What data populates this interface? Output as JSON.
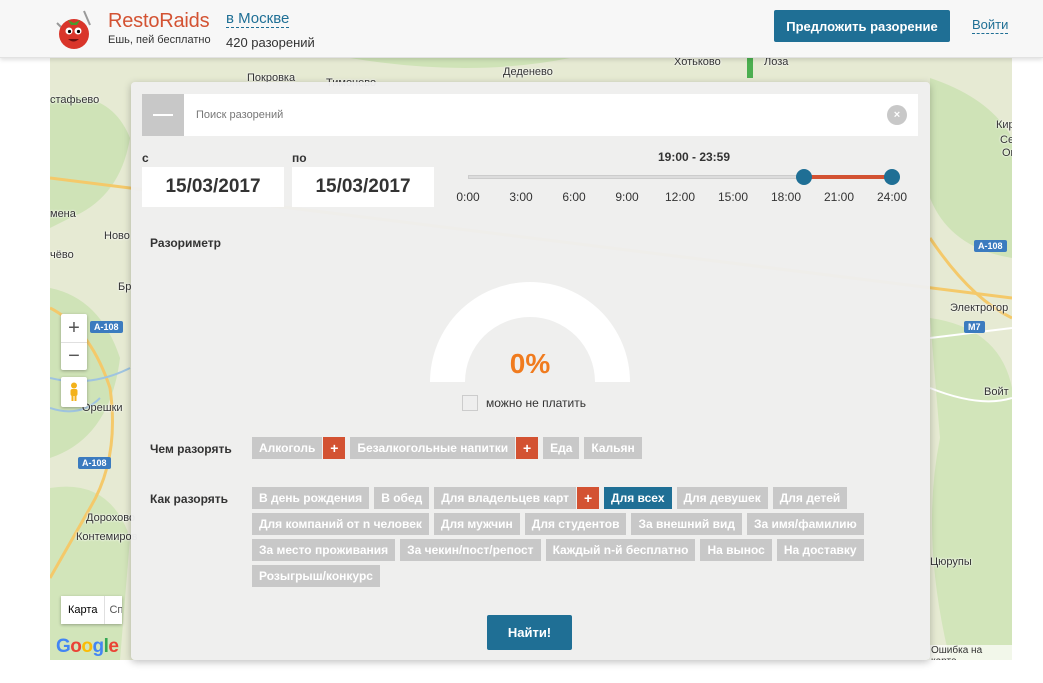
{
  "header": {
    "brand_name": "RestoRaids",
    "tagline": "Ешь, пей бесплатно",
    "city": "в Москве",
    "raid_count": "420 разорений",
    "propose_label": "Предложить разорение",
    "login_label": "Войти"
  },
  "map": {
    "labels": [
      "стафьево",
      "Покровка",
      "Тимонево",
      "Деденево",
      "Хотьково",
      "Лоза",
      "Кир",
      "Сер",
      "Ок",
      "мена",
      "Ново",
      "чёво",
      "Бр",
      "Орешки",
      "Дорохово",
      "Контемиров",
      "Электрогор",
      "Цюрупы",
      "Войт",
      "М7"
    ],
    "road_badges": [
      "А-108",
      "А-108",
      "А-108",
      "М7"
    ],
    "zoom_in": "+",
    "zoom_out": "−",
    "map_type_selected": "Карта",
    "map_type_other": "Спутник",
    "google_logo": "Google",
    "footer_text": "Ошибка на карте"
  },
  "search": {
    "placeholder": "Поиск разорений",
    "value": "",
    "clear_icon": "×"
  },
  "dates": {
    "from_label": "с",
    "from_value": "15/03/2017",
    "to_label": "по",
    "to_value": "15/03/2017"
  },
  "time": {
    "range_text": "19:00 - 23:59",
    "start_fraction": 0.7917,
    "end_fraction": 1.0,
    "ticks": [
      "0:00",
      "3:00",
      "6:00",
      "9:00",
      "12:00",
      "15:00",
      "18:00",
      "21:00",
      "24:00"
    ]
  },
  "razometer": {
    "title": "Разориметр",
    "percent": 0,
    "value_text": "0%",
    "checkbox_label": "можно не платить",
    "checkbox_checked": false
  },
  "what": {
    "title": "Чем разорять",
    "tags": [
      {
        "label": "Алкоголь",
        "plus": true,
        "active": false
      },
      {
        "label": "Безалкогольные напитки",
        "plus": true,
        "active": false
      },
      {
        "label": "Еда",
        "plus": false,
        "active": false
      },
      {
        "label": "Кальян",
        "plus": false,
        "active": false
      }
    ]
  },
  "how": {
    "title": "Как разорять",
    "tags": [
      {
        "label": "В день рождения",
        "plus": false,
        "active": false
      },
      {
        "label": "В обед",
        "plus": false,
        "active": false
      },
      {
        "label": "Для владельцев карт",
        "plus": true,
        "active": false
      },
      {
        "label": "Для всех",
        "plus": false,
        "active": true
      },
      {
        "label": "Для девушек",
        "plus": false,
        "active": false
      },
      {
        "label": "Для детей",
        "plus": false,
        "active": false
      },
      {
        "label": "Для компаний от n человек",
        "plus": false,
        "active": false
      },
      {
        "label": "Для мужчин",
        "plus": false,
        "active": false
      },
      {
        "label": "Для студентов",
        "plus": false,
        "active": false
      },
      {
        "label": "За внешний вид",
        "plus": false,
        "active": false
      },
      {
        "label": "За имя/фамилию",
        "plus": false,
        "active": false
      },
      {
        "label": "За место проживания",
        "plus": false,
        "active": false
      },
      {
        "label": "За чекин/пост/репост",
        "plus": false,
        "active": false
      },
      {
        "label": "Каждый n-й бесплатно",
        "plus": false,
        "active": false
      },
      {
        "label": "На вынос",
        "plus": false,
        "active": false
      },
      {
        "label": "На доставку",
        "plus": false,
        "active": false
      },
      {
        "label": "Розыгрыш/конкурс",
        "plus": false,
        "active": false
      }
    ]
  },
  "plus_symbol": "+",
  "find_label": "Найти!",
  "colors": {
    "primary": "#1f6f95",
    "accent": "#d35232",
    "gauge_value": "#f07b1e",
    "tag_inactive": "#c8c8c8"
  }
}
